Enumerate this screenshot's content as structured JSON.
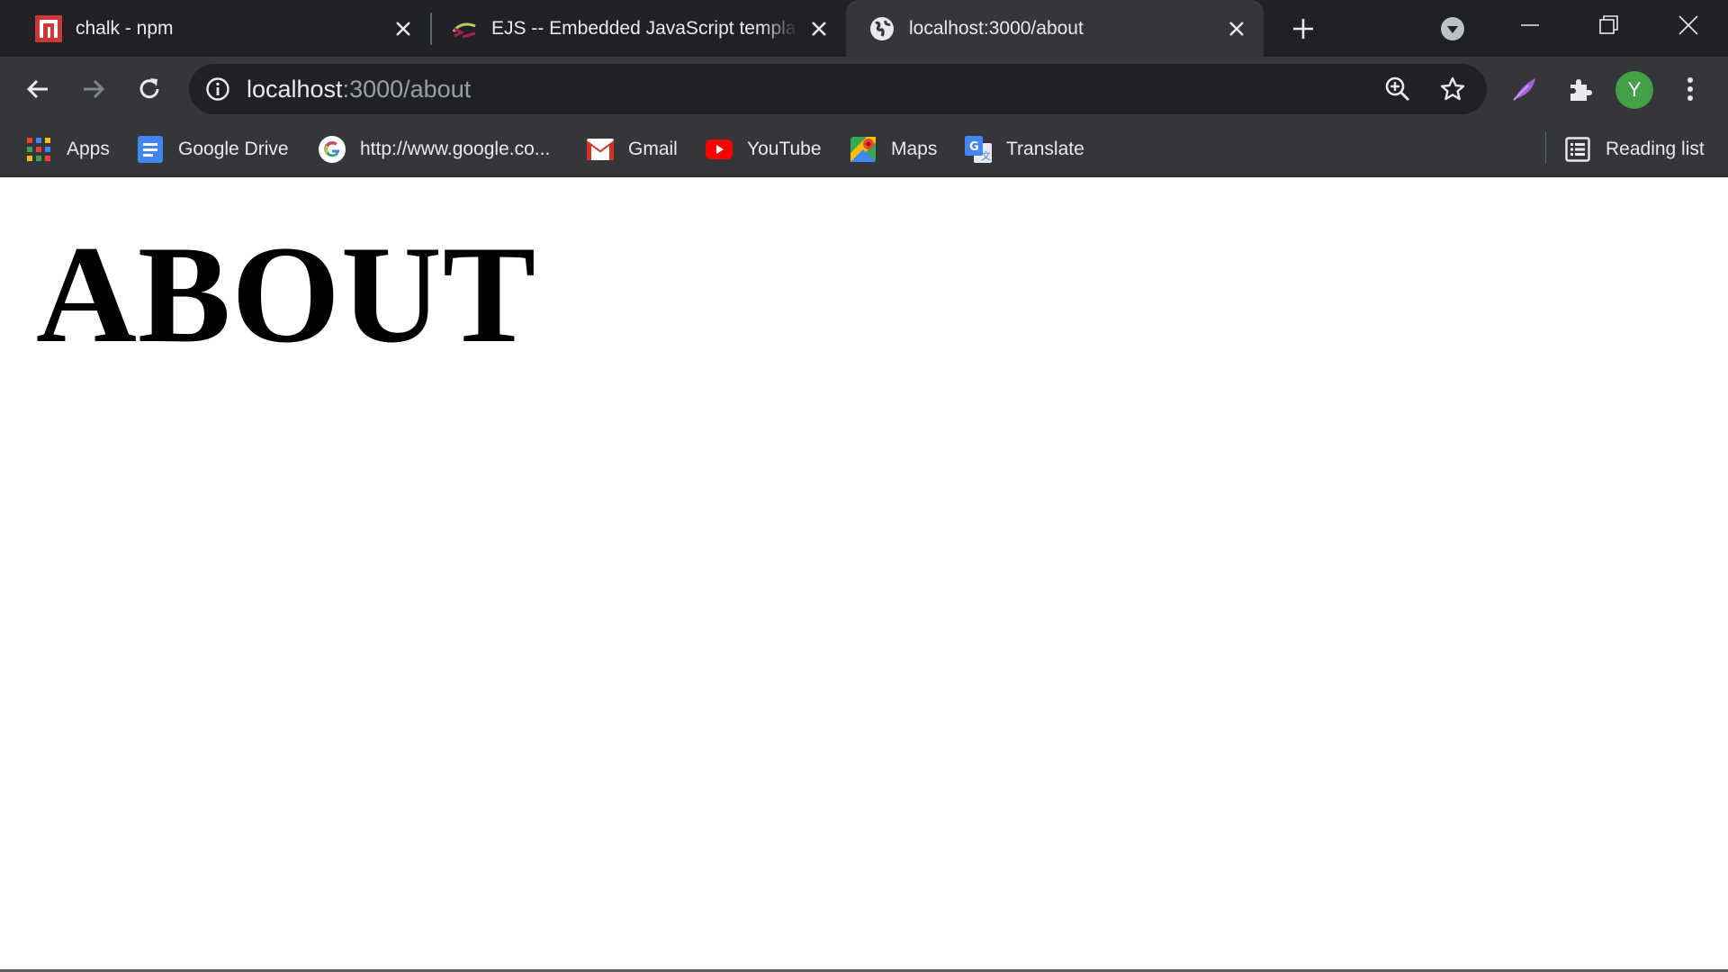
{
  "tabs": [
    {
      "title": "chalk - npm",
      "favicon": "npm-icon",
      "active": false
    },
    {
      "title": "EJS -- Embedded JavaScript templat",
      "favicon": "ejs-icon",
      "active": false
    },
    {
      "title": "localhost:3000/about",
      "favicon": "globe-icon",
      "active": true
    }
  ],
  "omnibox": {
    "host": "localhost",
    "path": ":3000/about"
  },
  "profile": {
    "initial": "Y"
  },
  "bookmarks": {
    "items": [
      {
        "label": "Apps",
        "icon": "apps-grid-icon"
      },
      {
        "label": "Google Drive",
        "icon": "google-docs-icon"
      },
      {
        "label": "http://www.google.co...",
        "icon": "google-icon"
      },
      {
        "label": "Gmail",
        "icon": "gmail-icon"
      },
      {
        "label": "YouTube",
        "icon": "youtube-icon"
      },
      {
        "label": "Maps",
        "icon": "maps-icon"
      },
      {
        "label": "Translate",
        "icon": "translate-icon"
      }
    ],
    "reading_list": "Reading list"
  },
  "page": {
    "heading": "ABOUT"
  },
  "colors": {
    "tabstrip": "#202124",
    "toolbar": "#35363a",
    "omnibox": "#202124",
    "text": "#e8eaed",
    "avatar": "#43a047"
  }
}
